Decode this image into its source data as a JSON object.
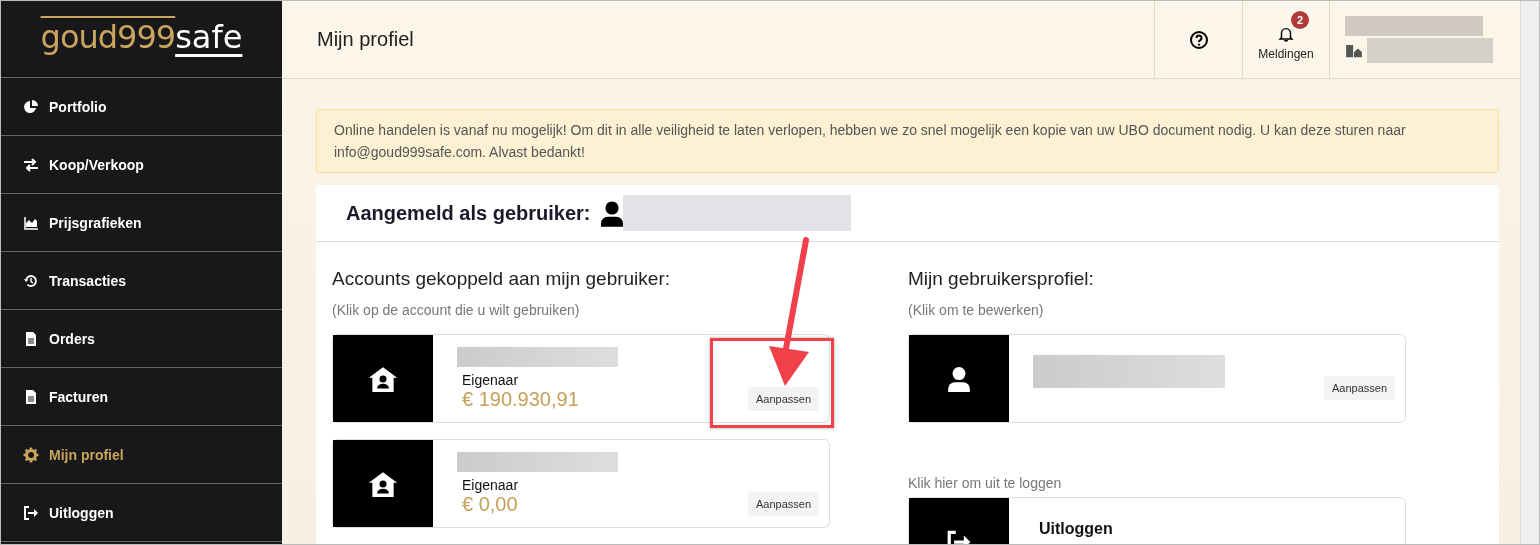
{
  "logo": {
    "part_1": "goud999",
    "part_2": "safe"
  },
  "sidebar": {
    "items": [
      {
        "label": "Portfolio",
        "selected": false
      },
      {
        "label": "Koop/Verkoop",
        "selected": false
      },
      {
        "label": "Prijsgrafieken",
        "selected": false
      },
      {
        "label": "Transacties",
        "selected": false
      },
      {
        "label": "Orders",
        "selected": false
      },
      {
        "label": "Facturen",
        "selected": false
      },
      {
        "label": "Mijn profiel",
        "selected": true
      },
      {
        "label": "Uitloggen",
        "selected": false
      }
    ]
  },
  "header": {
    "title": "Mijn profiel",
    "notifications": {
      "label": "Meldingen",
      "badge": "2"
    }
  },
  "alert": "Online handelen is vanaf nu mogelijk! Om dit in alle veiligheid te laten verlopen, hebben we zo snel mogelijk een kopie van uw UBO document nodig. U kan deze sturen naar info@goud999safe.com. Alvast bedankt!",
  "card": {
    "title": "Aangemeld als gebruiker:",
    "accounts": {
      "heading": "Accounts gekoppeld aan mijn gebruiker:",
      "hint": "(Klik op de account die u wilt gebruiken)",
      "items": [
        {
          "role": "Eigenaar",
          "amount": "€ 190.930,91",
          "button": "Aanpassen",
          "highlighted": true
        },
        {
          "role": "Eigenaar",
          "amount": "€ 0,00",
          "button": "Aanpassen",
          "highlighted": false
        }
      ]
    },
    "profile": {
      "heading": "Mijn gebruikersprofiel:",
      "hint": "(Klik om te bewerken)",
      "button": "Aanpassen"
    },
    "logout": {
      "hint": "Klik hier om uit te loggen",
      "label": "Uitloggen"
    }
  }
}
